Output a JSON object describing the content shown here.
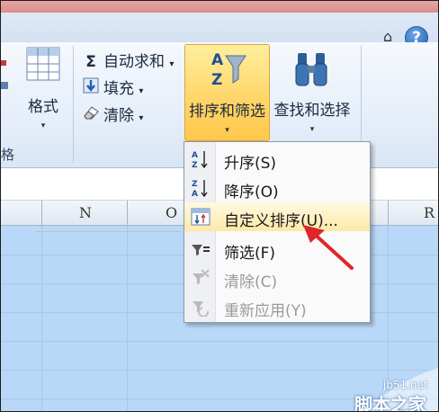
{
  "window": {
    "help_label": "?",
    "minimize_glyph": "⌂"
  },
  "ribbon": {
    "format_label": "格式",
    "group_cells_label": "格",
    "autosum_label": "自动求和",
    "fill_label": "填充",
    "clear_label": "清除",
    "sort_filter_label": "排序和筛选",
    "find_select_label": "查找和选择",
    "dropdown_glyph": "▾"
  },
  "columns": [
    "N",
    "O",
    "R"
  ],
  "sort_menu": {
    "items": [
      {
        "label": "升序(S)",
        "icon": "sort-ascending-icon",
        "enabled": true
      },
      {
        "label": "降序(O)",
        "icon": "sort-descending-icon",
        "enabled": true
      },
      {
        "label": "自定义排序(U)...",
        "icon": "custom-sort-icon",
        "enabled": true,
        "highlighted": true
      },
      {
        "label": "筛选(F)",
        "icon": "filter-icon",
        "enabled": true
      },
      {
        "label": "清除(C)",
        "icon": "clear-filter-icon",
        "enabled": false
      },
      {
        "label": "重新应用(Y)",
        "icon": "reapply-icon",
        "enabled": false
      }
    ]
  },
  "watermark": {
    "site": "jb51.net",
    "brand": "脚本之家"
  },
  "colors": {
    "selection": "#b9d7f7",
    "highlight": "#ffd466",
    "arrow": "#e0252a"
  }
}
